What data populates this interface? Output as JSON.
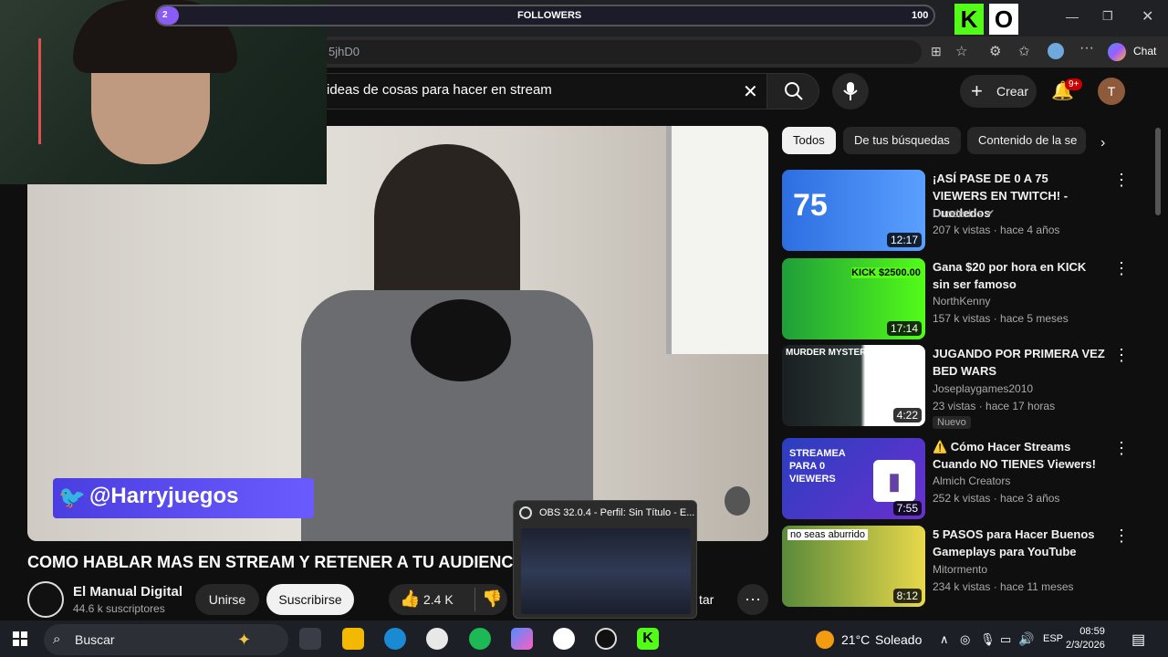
{
  "overlay": {
    "followers_label": "FOLLOWERS",
    "followers_current": "2",
    "followers_goal": "100",
    "progress": 0.02,
    "kick_badge": "K",
    "kick_badge2": "O"
  },
  "browser": {
    "url_fragment": "5jhD0",
    "chat_label": "Chat"
  },
  "youtube": {
    "search_query": "ideas de cosas para hacer en stream",
    "create_label": "Crear",
    "notifications_badge": "9+",
    "avatar_letter": "T"
  },
  "video": {
    "overlay_handle": "@Harryjuegos",
    "title": "COMO HABLAR MAS EN STREAM Y RETENER A TU AUDIENCIA",
    "channel_name": "El Manual Digital",
    "channel_subs": "44.6 k suscriptores",
    "join_label": "Unirse",
    "subscribe_label": "Suscribirse",
    "likes": "2.4 K",
    "partial_label": "tar"
  },
  "chips": [
    "Todos",
    "De tus búsquedas",
    "Contenido de la se"
  ],
  "recommendations": [
    {
      "title": "¡ASÍ PASE DE 0 A 75 VIEWERS EN TWITCH! - Duodedos",
      "channel": "Duodedos",
      "verified": true,
      "meta": "207 k vistas · hace 4 años",
      "duration": "12:17",
      "badge": "",
      "thumb_text": "75"
    },
    {
      "title": "Gana $20 por hora en KICK sin ser famoso",
      "channel": "NorthKenny",
      "verified": false,
      "meta": "157 k vistas · hace 5 meses",
      "duration": "17:14",
      "badge": "",
      "thumb_text": "KICK $2500.00"
    },
    {
      "title": "JUGANDO POR PRIMERA VEZ BED WARS",
      "channel": "Joseplaygames2010",
      "verified": false,
      "meta": "23 vistas · hace 17 horas",
      "duration": "4:22",
      "badge": "Nuevo",
      "thumb_text": "MURDER MYSTERY"
    },
    {
      "title": "⚠️ Cómo Hacer Streams Cuando NO TIENES Viewers!",
      "channel": "Almich Creators",
      "verified": false,
      "meta": "252 k vistas · hace 3 años",
      "duration": "7:55",
      "badge": "",
      "thumb_text": "STREAMEA PARA 0 VIEWERS"
    },
    {
      "title": "5 PASOS para Hacer Buenos Gameplays para YouTube",
      "channel": "Mitormento",
      "verified": false,
      "meta": "234 k vistas · hace 11 meses",
      "duration": "8:12",
      "badge": "",
      "thumb_text": "no seas aburrido"
    }
  ],
  "obs": {
    "title": "OBS 32.0.4 - Perfil: Sin Título - E..."
  },
  "taskbar": {
    "search_label": "Buscar",
    "weather": "21°C",
    "weather_desc": "Soleado",
    "lang": "ESP",
    "time": "08:59",
    "date": "2/3/2026"
  },
  "colors": {
    "youtube_bg": "#0f0f0f",
    "kick_green": "#53fc18",
    "notification_red": "#cc0000",
    "followers_purple": "#8a5cf6"
  }
}
